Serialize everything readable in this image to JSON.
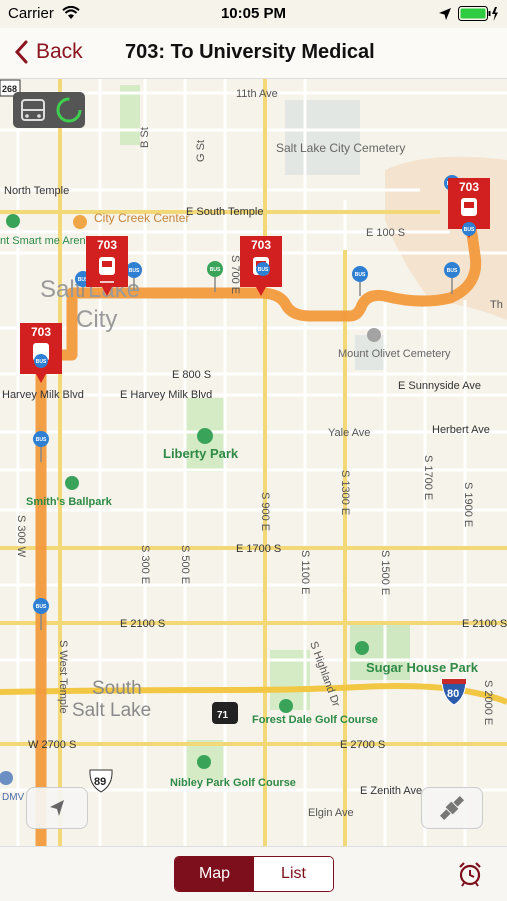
{
  "status": {
    "carrier": "Carrier",
    "time": "10:05 PM"
  },
  "nav": {
    "back_label": "Back",
    "title": "703: To University Medical"
  },
  "map": {
    "route_number": "703",
    "stop_badge": "BUS",
    "highway_shields": [
      "268",
      "89",
      "80",
      "71"
    ],
    "labels": {
      "ave_11th": "11th Ave",
      "b_st": "B St",
      "g_st": "G St",
      "cemetery": "Salt Lake City Cemetery",
      "north_temple": "North Temple",
      "city_creek": "City Creek Center",
      "e_south_temple": "E South Temple",
      "e_100_s": "E 100 S",
      "smart_arena": "nt Smart me Arena",
      "salt_lake": "Salt Lake",
      "city": "City",
      "mount_olivet": "Mount Olivet Cemetery",
      "e_800_s": "E 800 S",
      "e_sunnyside": "E Sunnyside Ave",
      "harvey_milk_w": "Harvey Milk Blvd",
      "harvey_milk_e": "E Harvey Milk Blvd",
      "liberty_park": "Liberty Park",
      "yale_ave": "Yale Ave",
      "herbert_ave": "Herbert Ave",
      "smiths_ballpark": "Smith's Ballpark",
      "e_1700_s": "E 1700 S",
      "e_2100_s": "E 2100 S",
      "e_2100_s_east": "E 2100 S",
      "s_300_w": "S 300 W",
      "s_300_e": "S 300 E",
      "s_500_e": "S 500 E",
      "s_900_e": "S 900 E",
      "s_700_e": "S 700 E",
      "s_1100_e": "S 1100 E",
      "s_1300_e": "S 1300 E",
      "s_1500_e": "S 1500 E",
      "s_1700_e": "S 1700 E",
      "s_1900_e": "S 1900 E",
      "s_2000_e": "S 2000 E",
      "s_west_temple": "S West Temple",
      "s_highland": "S Highland Dr",
      "sugar_house": "Sugar House Park",
      "south_salt_lake_1": "South",
      "south_salt_lake_2": "Salt Lake",
      "forest_dale": "Forest Dale Golf Course",
      "w_2700_s": "W 2700 S",
      "e_2700_s": "E 2700 S",
      "nibley": "Nibley Park Golf Course",
      "elgin": "Elgin Ave",
      "e_zenith": "E Zenith Ave",
      "dmv": "DMV",
      "the_th": "Th"
    }
  },
  "tabs": {
    "map_label": "Map",
    "list_label": "List"
  },
  "colors": {
    "brand": "#7d0f1c",
    "route": "#f29a3d",
    "marker": "#d21f1f",
    "stop": "#2f7fd3"
  }
}
